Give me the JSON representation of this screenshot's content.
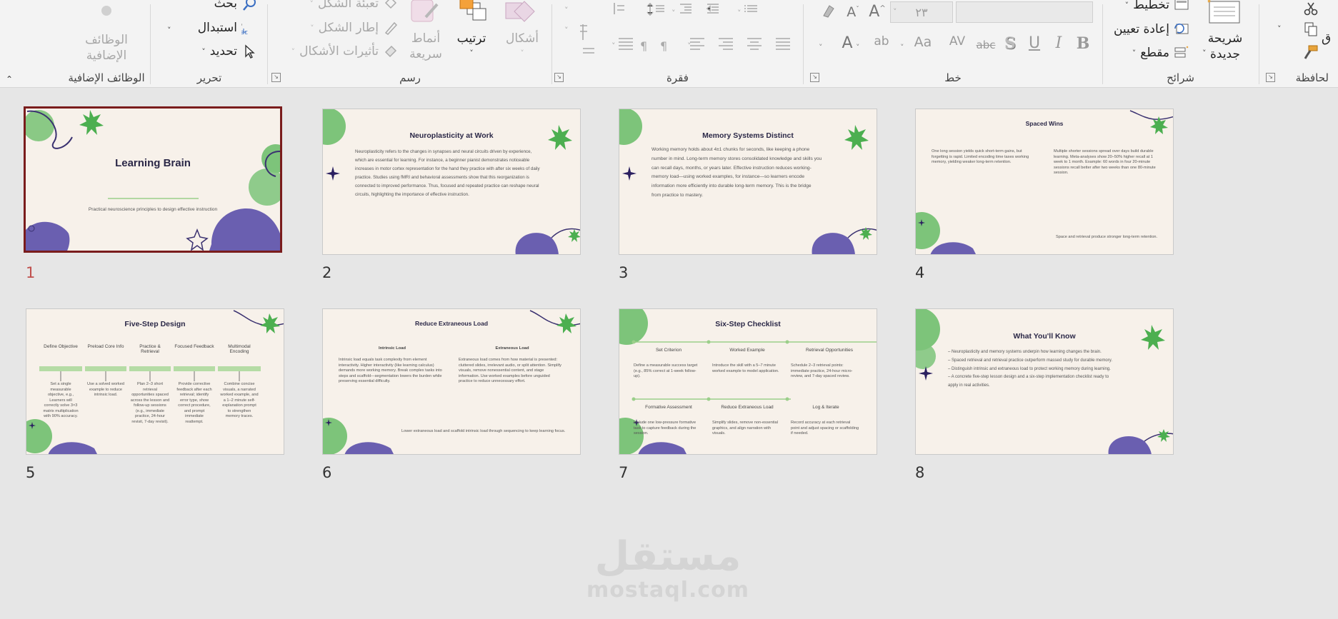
{
  "ribbon": {
    "groups": {
      "clipboard": "لحافظة",
      "slides": "شرائح",
      "font": "خط",
      "paragraph": "فقرة",
      "drawing": "رسم",
      "editing": "تحرير",
      "addins": "الوظائف الإضافية"
    },
    "slides_group": {
      "new_slide_line1": "شريحة",
      "new_slide_line2": "جديدة",
      "layout": "تخطيط",
      "reset": "إعادة تعيين",
      "section": "مقطع"
    },
    "font_group": {
      "font_size": "٢٣",
      "font_name": ""
    },
    "drawing_group": {
      "shapes": "أشكال",
      "arrange": "ترتيب",
      "quick_styles_line1": "أنماط",
      "quick_styles_line2": "سريعة",
      "shape_fill": "تعبئة الشكل",
      "shape_outline": "إطار الشكل",
      "shape_effects": "تأثيرات الأشكال"
    },
    "editing_group": {
      "find": "بحث",
      "replace": "استبدال",
      "select": "تحديد"
    },
    "addins_group": {
      "addins_line1": "الوظائف",
      "addins_line2": "الإضافية"
    },
    "icons": [
      "cut-icon",
      "copy-icon",
      "format-painter-icon",
      "layout-icon",
      "reset-icon",
      "section-icon",
      "bold-icon",
      "italic-icon",
      "underline-icon",
      "shadow-icon",
      "strikethrough-icon",
      "search-icon",
      "replace-icon",
      "select-icon"
    ]
  },
  "slides": [
    {
      "number": "1",
      "title": "Learning Brain",
      "subtitle": "Practical neuroscience principles to design effective instruction"
    },
    {
      "number": "2",
      "title": "Neuroplasticity at Work",
      "body": [
        "Neuroplasticity refers to the changes in synapses and neural circuits driven by experience,",
        "which are essential for learning. For instance, a beginner pianist demonstrates noticeable",
        "increases in motor cortex representation for the hand they practice with after six weeks of daily",
        "practice. Studies using fMRI and behavioral assessments show that this reorganization is",
        "connected to improved performance. Thus, focused and repeated practice can reshape neural",
        "circuits, highlighting the importance of effective instruction."
      ]
    },
    {
      "number": "3",
      "title": "Memory Systems Distinct",
      "body": [
        "Working memory holds about 4±1 chunks for seconds, like keeping a phone",
        "number in mind. Long-term memory stores consolidated knowledge and skills you",
        "can recall days, months, or years later. Effective instruction reduces working-",
        "memory load—using worked examples, for instance—so learners encode",
        "information more efficiently into durable long-term memory. This is the bridge",
        "from practice to mastery."
      ]
    },
    {
      "number": "4",
      "title": "Spaced Wins",
      "left": [
        "One long session yields quick short-term gains, but",
        "forgetting is rapid. Limited encoding time taxes working",
        "memory, yielding weaker long-term retention."
      ],
      "right": [
        "Multiple shorter sessions spread over days build durable",
        "learning. Meta-analyses show 20–50% higher recall at 1",
        "week to 1 month. Example: 60 words in four 20-minute",
        "sessions recall better after two weeks than one 80-minute",
        "session."
      ],
      "footer": "Space and retrieval produce stronger long-term retention."
    },
    {
      "number": "5",
      "title": "Five-Step Design",
      "steps": [
        {
          "head": [
            "Define Objective"
          ],
          "text": [
            "Set a single",
            "measurable",
            "objective, e.g.,",
            "Learners will",
            "correctly solve 3×3",
            "matrix multiplication",
            "with 90% accuracy."
          ]
        },
        {
          "head": [
            "Preload Core Info"
          ],
          "text": [
            "Use a solved worked",
            "example to reduce",
            "intrinsic load."
          ]
        },
        {
          "head": [
            "Practice &",
            "Retrieval"
          ],
          "text": [
            "Plan 2–3 short",
            "retrieval",
            "opportunities spaced",
            "across the lesson and",
            "follow-up sessions",
            "(e.g., immediate",
            "practice, 24-hour",
            "revisit, 7-day revisit)."
          ]
        },
        {
          "head": [
            "Focused Feedback"
          ],
          "text": [
            "Provide corrective",
            "feedback after each",
            "retrieval; identify",
            "error type, show",
            "correct procedure,",
            "and prompt",
            "immediate",
            "reattempt."
          ]
        },
        {
          "head": [
            "Multimodal",
            "Encoding"
          ],
          "text": [
            "Combine concise",
            "visuals, a narrated",
            "worked example, and",
            "a 1–2 minute self-",
            "explanation prompt",
            "to strengthen",
            "memory traces."
          ]
        }
      ]
    },
    {
      "number": "6",
      "title": "Reduce Extraneous Load",
      "left_head": "Intrinsic Load",
      "left": [
        "Intrinsic load equals task complexity from element",
        "interactivity. Higher interactivity (like learning calculus)",
        "demands more working memory. Break complex tasks into",
        "steps and scaffold—segmentation lowers the burden while",
        "preserving essential difficulty."
      ],
      "right_head": "Extraneous Load",
      "right": [
        "Extraneous load comes from how material is presented:",
        "cluttered slides, irrelevant audio, or split attention. Simplify",
        "visuals, remove nonessential content, and stage",
        "information. Use worked examples before unguided",
        "practice to reduce unnecessary effort."
      ],
      "footer": "Lower extraneous load and scaffold intrinsic load through sequencing to keep learning focus."
    },
    {
      "number": "7",
      "title": "Six-Step Checklist",
      "top": [
        {
          "head": "Set Criterion",
          "text": [
            "Define a measurable success target",
            "(e.g., 85% correct at 1-week follow-",
            "up)."
          ]
        },
        {
          "head": "Worked Example",
          "text": [
            "Introduce the skill with a 5–7 minute",
            "worked example to model application."
          ]
        },
        {
          "head": "Retrieval Opportunities",
          "text": [
            "Schedule 2–3 retrieval points:",
            "immediate practice, 24-hour micro-",
            "review, and 7-day spaced review."
          ]
        }
      ],
      "bottom": [
        {
          "head": "Formative Assessment",
          "text": [
            "Include one low-pressure formative",
            "task to capture feedback during the",
            "session."
          ]
        },
        {
          "head": "Reduce Extraneous Load",
          "text": [
            "Simplify slides, remove non-essential",
            "graphics, and align narration with",
            "visuals."
          ]
        },
        {
          "head": "Log & Iterate",
          "text": [
            "Record accuracy at each retrieval",
            "point and adjust spacing or scaffolding",
            "if needed."
          ]
        }
      ]
    },
    {
      "number": "8",
      "title": "What You'll Know",
      "bullets": [
        "– Neuroplasticity and memory systems underpin how learning changes the brain.",
        "– Spaced retrieval and retrieval practice outperform massed study for durable memory.",
        "– Distinguish intrinsic and extraneous load to protect working memory during learning.",
        "– A concrete five-step lesson design and a six-step implementation checklist ready to",
        "apply in real activities."
      ]
    }
  ],
  "watermark": {
    "arabic": "مستقل",
    "latin": "mostaql.com"
  },
  "colors": {
    "slide_bg": "#f7f1ea",
    "title": "#2b2847",
    "green_accent": "#4caf50",
    "purple_blob": "#6a5fb0",
    "selection_border": "#7a1c1c",
    "selected_number": "#c0504d"
  }
}
